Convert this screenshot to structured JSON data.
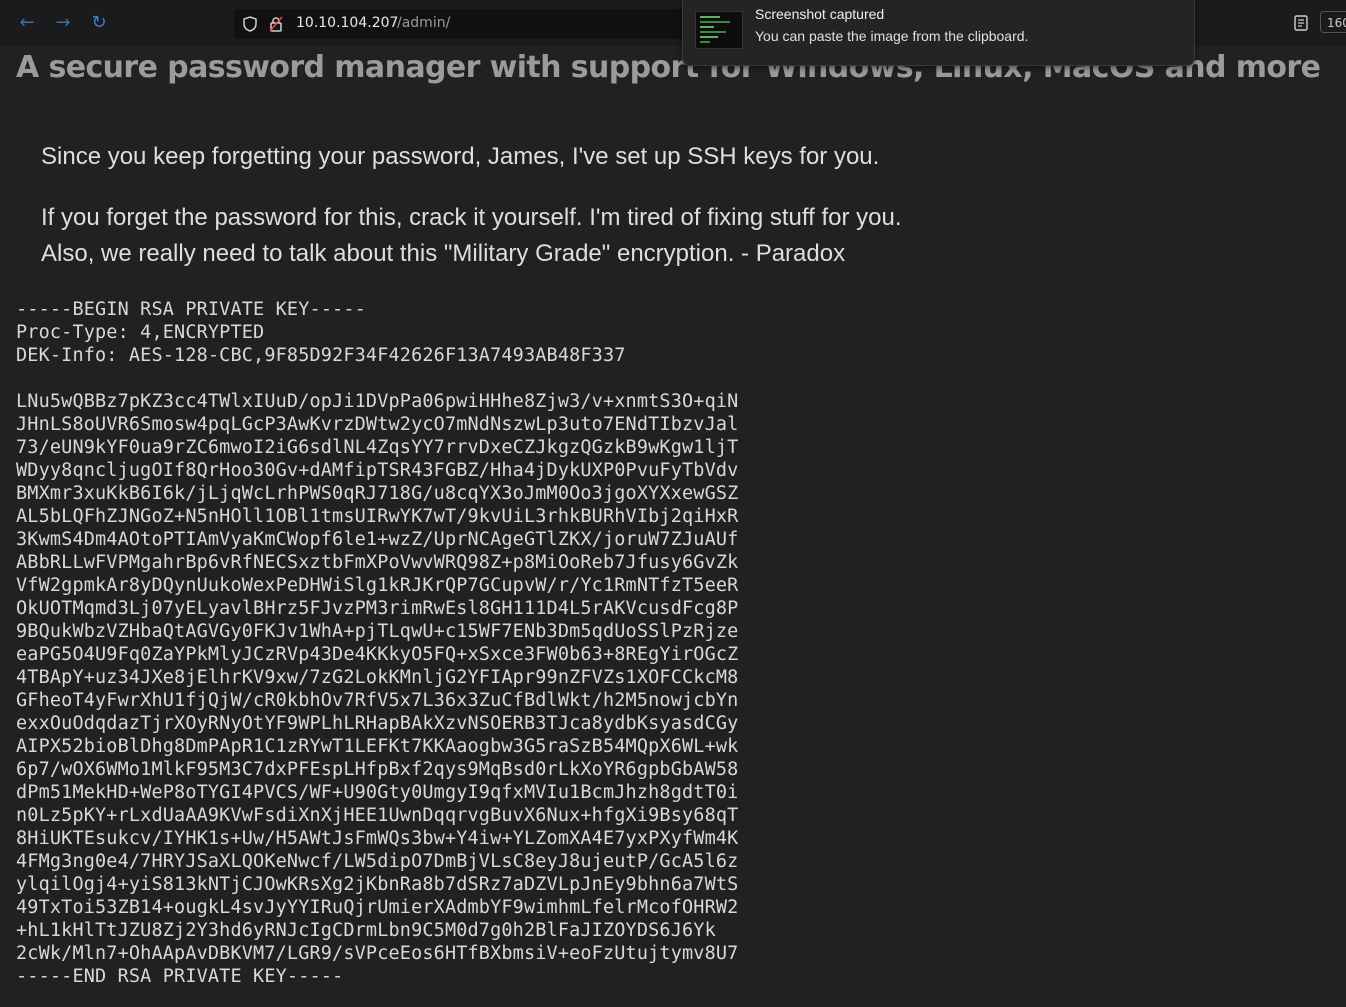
{
  "browser": {
    "url_host": "10.10.104.207",
    "url_path": "/admin/",
    "zoom_label": "160"
  },
  "notification": {
    "title": "Screenshot captured",
    "message": "You can paste the image from the clipboard."
  },
  "page": {
    "headline": "A secure password manager with support for Windows, Linux, MacOS and more",
    "message_line1": "Since you keep forgetting your password, James, I've set up SSH keys for you.",
    "message_line2": "If you forget the password for this, crack it yourself. I'm tired of fixing stuff for you.",
    "message_line3": "Also, we really need to talk about this \"Military Grade\" encryption. - Paradox"
  },
  "private_key": {
    "lines": [
      "-----BEGIN RSA PRIVATE KEY-----",
      "Proc-Type: 4,ENCRYPTED",
      "DEK-Info: AES-128-CBC,9F85D92F34F42626F13A7493AB48F337",
      "",
      "LNu5wQBBz7pKZ3cc4TWlxIUuD/opJi1DVpPa06pwiHHhe8Zjw3/v+xnmtS3O+qiN",
      "JHnLS8oUVR6Smosw4pqLGcP3AwKvrzDWtw2ycO7mNdNszwLp3uto7ENdTIbzvJal",
      "73/eUN9kYF0ua9rZC6mwoI2iG6sdlNL4ZqsYY7rrvDxeCZJkgzQGzkB9wKgw1ljT",
      "WDyy8qncljugOIf8QrHoo30Gv+dAMfipTSR43FGBZ/Hha4jDykUXP0PvuFyTbVdv",
      "BMXmr3xuKkB6I6k/jLjqWcLrhPWS0qRJ718G/u8cqYX3oJmM0Oo3jgoXYXxewGSZ",
      "AL5bLQFhZJNGoZ+N5nHOll1OBl1tmsUIRwYK7wT/9kvUiL3rhkBURhVIbj2qiHxR",
      "3KwmS4Dm4AOtoPTIAmVyaKmCWopf6le1+wzZ/UprNCAgeGTlZKX/joruW7ZJuAUf",
      "ABbRLLwFVPMgahrBp6vRfNECSxztbFmXPoVwvWRQ98Z+p8MiOoReb7Jfusy6GvZk",
      "VfW2gpmkAr8yDQynUukoWexPeDHWiSlg1kRJKrQP7GCupvW/r/Yc1RmNTfzT5eeR",
      "OkUOTMqmd3Lj07yELyavlBHrz5FJvzPM3rimRwEsl8GH111D4L5rAKVcusdFcg8P",
      "9BQukWbzVZHbaQtAGVGy0FKJv1WhA+pjTLqwU+c15WF7ENb3Dm5qdUoSSlPzRjze",
      "eaPG5O4U9Fq0ZaYPkMlyJCzRVp43De4KKkyO5FQ+xSxce3FW0b63+8REgYirOGcZ",
      "4TBApY+uz34JXe8jElhrKV9xw/7zG2LokKMnljG2YFIApr99nZFVZs1XOFCCkcM8",
      "GFheoT4yFwrXhU1fjQjW/cR0kbhOv7RfV5x7L36x3ZuCfBdlWkt/h2M5nowjcbYn",
      "exxOuOdqdazTjrXOyRNyOtYF9WPLhLRHapBAkXzvNSOERB3TJca8ydbKsyasdCGy",
      "AIPX52bioBlDhg8DmPApR1C1zRYwT1LEFKt7KKAaogbw3G5raSzB54MQpX6WL+wk",
      "6p7/wOX6WMo1MlkF95M3C7dxPFEspLHfpBxf2qys9MqBsd0rLkXoYR6gpbGbAW58",
      "dPm51MekHD+WeP8oTYGI4PVCS/WF+U90Gty0UmgyI9qfxMVIu1BcmJhzh8gdtT0i",
      "n0Lz5pKY+rLxdUaAA9KVwFsdiXnXjHEE1UwnDqqrvgBuvX6Nux+hfgXi9Bsy68qT",
      "8HiUKTEsukcv/IYHK1s+Uw/H5AWtJsFmWQs3bw+Y4iw+YLZomXA4E7yxPXyfWm4K",
      "4FMg3ng0e4/7HRYJSaXLQOKeNwcf/LW5dipO7DmBjVLsC8eyJ8ujeutP/GcA5l6z",
      "ylqilOgj4+yiS813kNTjCJOwKRsXg2jKbnRa8b7dSRz7aDZVLpJnEy9bhn6a7WtS",
      "49TxToi53ZB14+ougkL4svJyYYIRuQjrUmierXAdmbYF9wimhmLfelrMcofOHRW2",
      "+hL1kHlTtJZU8Zj2Y3hd6yRNJcIgCDrmLbn9C5M0d7g0h2BlFaJIZOYDS6J6Yk",
      "2cWk/Mln7+OhAApAvDBKVM7/LGR9/sVPceEos6HTfBXbmsiV+eoFzUtujtymv8U7",
      "-----END RSA PRIVATE KEY-----"
    ]
  }
}
